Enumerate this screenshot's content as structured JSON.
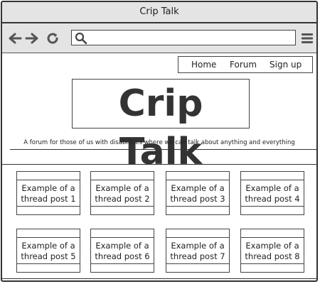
{
  "window": {
    "title": "Crip Talk"
  },
  "toolbar": {
    "url_value": "",
    "icons": [
      "arrow-left-icon",
      "arrow-right-icon",
      "refresh-icon",
      "search-icon",
      "hamburger-menu-icon"
    ]
  },
  "nav": {
    "items": [
      {
        "label": "Home"
      },
      {
        "label": "Forum"
      },
      {
        "label": "Sign up"
      }
    ]
  },
  "header": {
    "logo_text": "Crip Talk",
    "tagline": "A forum for those of us with disabilities where we can talk about anything and everything"
  },
  "posts": [
    {
      "line1": "Example of a",
      "line2": "thread post 1"
    },
    {
      "line1": "Example of a",
      "line2": "thread post 2"
    },
    {
      "line1": "Example of a",
      "line2": "thread post 3"
    },
    {
      "line1": "Example of a",
      "line2": "thread post 4"
    },
    {
      "line1": "Example of a",
      "line2": "thread post 5"
    },
    {
      "line1": "Example of a",
      "line2": "thread post 6"
    },
    {
      "line1": "Example of a",
      "line2": "thread post 7"
    },
    {
      "line1": "Example of a",
      "line2": "thread post 8"
    }
  ],
  "colors": {
    "chrome": "#e4e4e4",
    "stroke": "#333333",
    "text": "#222222"
  }
}
